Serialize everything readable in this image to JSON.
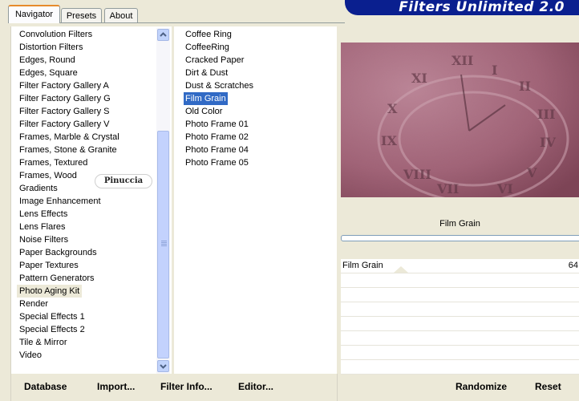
{
  "tabs": [
    {
      "label": "Navigator",
      "active": true
    },
    {
      "label": "Presets",
      "active": false
    },
    {
      "label": "About",
      "active": false
    }
  ],
  "brand": "Filters Unlimited 2.0",
  "categories": [
    "Convolution Filters",
    "Distortion Filters",
    "Edges, Round",
    "Edges, Square",
    "Filter Factory Gallery A",
    "Filter Factory Gallery G",
    "Filter Factory Gallery S",
    "Filter Factory Gallery V",
    "Frames, Marble & Crystal",
    "Frames, Stone & Granite",
    "Frames, Textured",
    "Frames, Wood",
    "Gradients",
    "Image Enhancement",
    "Lens Effects",
    "Lens Flares",
    "Noise Filters",
    "Paper Backgrounds",
    "Paper Textures",
    "Pattern Generators",
    "Photo Aging Kit",
    "Render",
    "Special Effects 1",
    "Special Effects 2",
    "Tile & Mirror",
    "Video"
  ],
  "selected_category": "Photo Aging Kit",
  "filters": [
    "Coffee Ring",
    "CoffeeRing",
    "Cracked Paper",
    "Dirt & Dust",
    "Dust & Scratches",
    "Film Grain",
    "Old Color",
    "Photo Frame 01",
    "Photo Frame 02",
    "Photo Frame 04",
    "Photo Frame 05"
  ],
  "selected_filter": "Film Grain",
  "watermark": "Pinuccia",
  "filter_name": "Film Grain",
  "params": [
    {
      "label": "Film Grain",
      "value": "64"
    }
  ],
  "buttons": {
    "database": "Database",
    "import": "Import...",
    "filter_info": "Filter Info...",
    "editor": "Editor...",
    "randomize": "Randomize",
    "reset": "Reset"
  },
  "colors": {
    "banner": "#0a1f8f",
    "selection": "#316ac5",
    "preview_tint": "#a8677c"
  },
  "icons": {
    "scroll_up": "chevron-up-icon",
    "scroll_down": "chevron-down-icon"
  }
}
